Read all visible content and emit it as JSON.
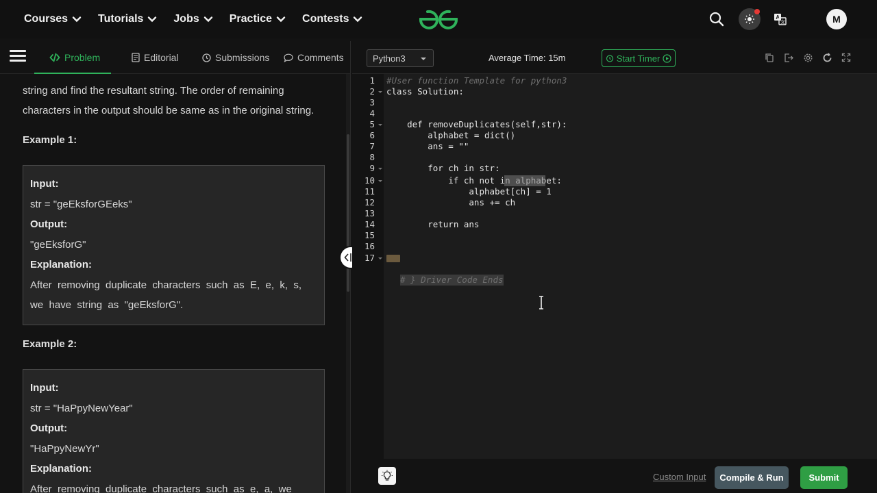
{
  "navbar": {
    "items": [
      {
        "label": "Courses"
      },
      {
        "label": "Tutorials"
      },
      {
        "label": "Jobs"
      },
      {
        "label": "Practice"
      },
      {
        "label": "Contests"
      }
    ],
    "logo_icon": "geeksforgeeks-logo",
    "avatar_initial": "M",
    "accent": "#2fb35b"
  },
  "problem_tabs": [
    {
      "label": "Problem",
      "icon": "code-icon",
      "active": true
    },
    {
      "label": "Editorial",
      "icon": "document-icon"
    },
    {
      "label": "Submissions",
      "icon": "clock-icon"
    },
    {
      "label": "Comments",
      "icon": "chat-icon"
    }
  ],
  "problem": {
    "description_line1": "string and find the resultant string. The order of remaining",
    "description_line2": "characters in the output should be same as in the original string.",
    "example1": {
      "title": "Example 1:",
      "input_label": "Input:",
      "input_value": "str = \"geEksforGEeks\"",
      "output_label": "Output:",
      "output_value": "\"geEksforG\"",
      "explanation_label": "Explanation:",
      "explanation_line1": "After  removing  duplicate  characters  such  as  E,  e,  k,  s,",
      "explanation_line2": "we  have  string  as  \"geEksforG\"."
    },
    "example2": {
      "title": "Example 2:",
      "input_label": "Input:",
      "input_value": "str = \"HaPpyNewYear\"",
      "output_label": "Output:",
      "output_value": "\"HaPpyNewYr\"",
      "explanation_label": "Explanation:",
      "explanation_line1": "After  removing  duplicate  characters  such  as  e,  a,  we"
    }
  },
  "editor": {
    "language": "Python3",
    "average_time": "Average Time: 15m",
    "start_timer": "Start Timer",
    "current_line": 10,
    "lines": [
      {
        "n": "1",
        "text": "#User function Template for python3"
      },
      {
        "n": "2",
        "text": "class Solution:"
      },
      {
        "n": "3",
        "text": ""
      },
      {
        "n": "4",
        "text": ""
      },
      {
        "n": "5",
        "text": "    def removeDuplicates(self,str):"
      },
      {
        "n": "6",
        "text": "        alphabet = dict()"
      },
      {
        "n": "7",
        "text": "        ans = \"\""
      },
      {
        "n": "8",
        "text": ""
      },
      {
        "n": "9",
        "text": "        for ch in str:"
      },
      {
        "n": "10",
        "text": "            if ch not in alphabet:"
      },
      {
        "n": "11",
        "text": "                alphabet[ch] = 1"
      },
      {
        "n": "12",
        "text": "                ans += ch"
      },
      {
        "n": "13",
        "text": ""
      },
      {
        "n": "14",
        "text": "        return ans"
      },
      {
        "n": "15",
        "text": ""
      },
      {
        "n": "16",
        "text": ""
      },
      {
        "n": "17",
        "text": "# } Driver Code Ends"
      }
    ]
  },
  "bottom": {
    "custom_input": "Custom Input",
    "compile_run": "Compile & Run",
    "submit": "Submit"
  }
}
